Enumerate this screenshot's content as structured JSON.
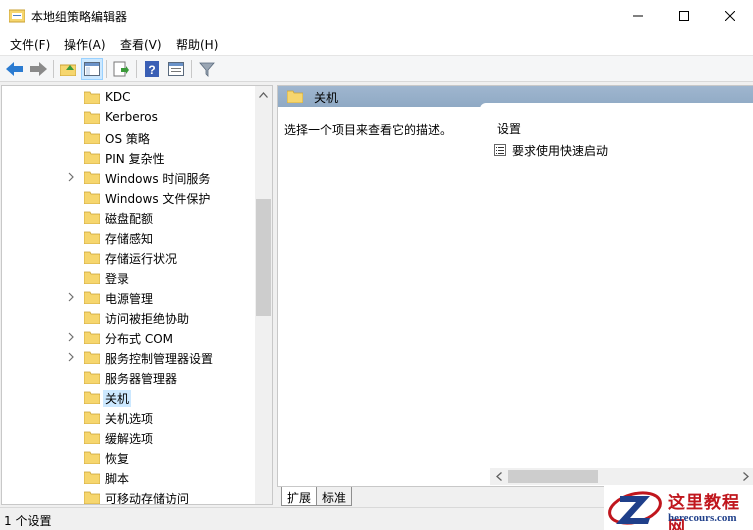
{
  "window": {
    "title": "本地组策略编辑器"
  },
  "menu": [
    "文件(F)",
    "操作(A)",
    "查看(V)",
    "帮助(H)"
  ],
  "toolbar": {
    "icons": [
      "back-arrow-icon",
      "forward-arrow-icon",
      "up-folder-icon",
      "show-hide-tree-icon",
      "export-list-icon",
      "help-icon",
      "properties-icon",
      "filter-icon"
    ]
  },
  "tree": {
    "items": [
      {
        "label": "KDC",
        "expandable": false
      },
      {
        "label": "Kerberos",
        "expandable": false
      },
      {
        "label": "OS 策略",
        "expandable": false
      },
      {
        "label": "PIN 复杂性",
        "expandable": false
      },
      {
        "label": "Windows 时间服务",
        "expandable": true
      },
      {
        "label": "Windows 文件保护",
        "expandable": false
      },
      {
        "label": "磁盘配额",
        "expandable": false
      },
      {
        "label": "存储感知",
        "expandable": false
      },
      {
        "label": "存储运行状况",
        "expandable": false
      },
      {
        "label": "登录",
        "expandable": false
      },
      {
        "label": "电源管理",
        "expandable": true
      },
      {
        "label": "访问被拒绝协助",
        "expandable": false
      },
      {
        "label": "分布式 COM",
        "expandable": true
      },
      {
        "label": "服务控制管理器设置",
        "expandable": true
      },
      {
        "label": "服务器管理器",
        "expandable": false
      },
      {
        "label": "关机",
        "expandable": false,
        "selected": true
      },
      {
        "label": "关机选项",
        "expandable": false
      },
      {
        "label": "缓解选项",
        "expandable": false
      },
      {
        "label": "恢复",
        "expandable": false
      },
      {
        "label": "脚本",
        "expandable": false
      },
      {
        "label": "可移动存储访问",
        "expandable": false
      }
    ]
  },
  "details": {
    "header_title": "关机",
    "description": "选择一个项目来查看它的描述。",
    "column_header": "设置",
    "settings": [
      "要求使用快速启动"
    ]
  },
  "tabs": {
    "expand": "扩展",
    "standard": "标准"
  },
  "status": {
    "text": "1 个设置"
  },
  "watermark": {
    "cn": "这里教程网",
    "en": "herecours.com"
  },
  "colors": {
    "selection": "#cce8ff",
    "header_bar": "#99b4d1",
    "folder": "#f6d66e"
  }
}
